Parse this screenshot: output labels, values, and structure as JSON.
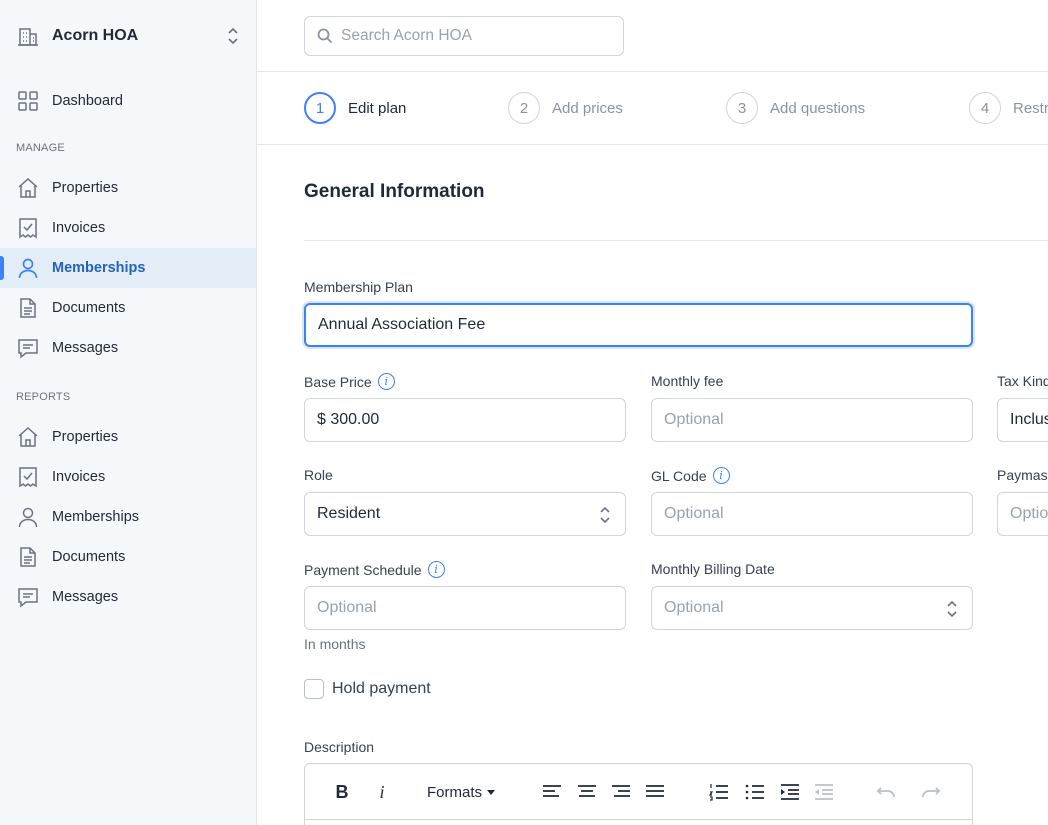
{
  "org": {
    "name": "Acorn HOA"
  },
  "sidebar": {
    "dashboard": "Dashboard",
    "manage_label": "MANAGE",
    "manage": [
      "Properties",
      "Invoices",
      "Memberships",
      "Documents",
      "Messages"
    ],
    "reports_label": "REPORTS",
    "reports": [
      "Properties",
      "Invoices",
      "Memberships",
      "Documents",
      "Messages"
    ],
    "active": "Memberships"
  },
  "search": {
    "placeholder": "Search Acorn HOA"
  },
  "steps": [
    {
      "num": "1",
      "label": "Edit plan"
    },
    {
      "num": "2",
      "label": "Add prices"
    },
    {
      "num": "3",
      "label": "Add questions"
    },
    {
      "num": "4",
      "label": "Restrictions"
    }
  ],
  "form": {
    "section_title": "General Information",
    "membership_plan": {
      "label": "Membership Plan",
      "value": "Annual Association Fee"
    },
    "base_price": {
      "label": "Base Price",
      "value": "$ 300.00"
    },
    "monthly_fee": {
      "label": "Monthly fee",
      "placeholder": "Optional"
    },
    "tax_kind": {
      "label": "Tax Kind",
      "value": "Inclusive"
    },
    "role": {
      "label": "Role",
      "value": "Resident"
    },
    "gl_code": {
      "label": "GL Code",
      "placeholder": "Optional"
    },
    "paymaster": {
      "label": "Paymaster",
      "placeholder": "Optional"
    },
    "payment_schedule": {
      "label": "Payment Schedule",
      "placeholder": "Optional",
      "hint": "In months"
    },
    "monthly_billing_date": {
      "label": "Monthly Billing Date",
      "placeholder": "Optional"
    },
    "hold_payment": {
      "label": "Hold payment",
      "checked": false
    },
    "description": {
      "label": "Description",
      "formats_label": "Formats"
    }
  },
  "colors": {
    "accent": "#3b82f6",
    "active_bg": "#e2edf8",
    "sidebar_bg": "#f5f8fb"
  }
}
